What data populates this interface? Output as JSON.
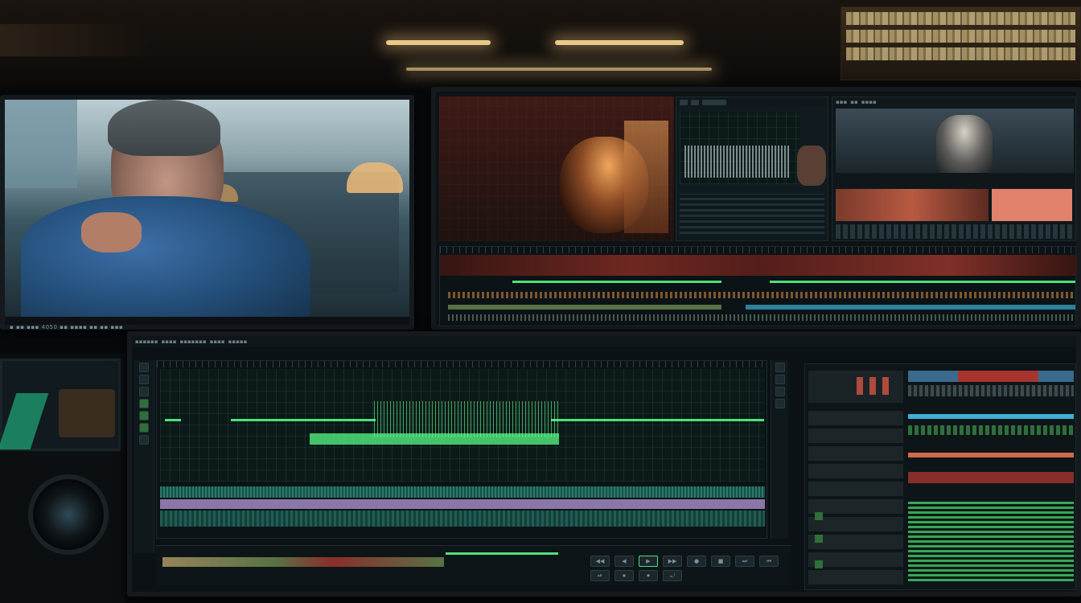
{
  "left_monitor": {
    "status_text": "▪ ▪▪ ▪▪▪ 4050 ▪▪ ▪▪▪▪ ▪▪ ▪▪ ▪▪▪"
  },
  "top_right_monitor": {
    "tabs": [
      "▪▪▪",
      "▪▪",
      "▪▪▪▪"
    ]
  },
  "main_editor": {
    "menu_items": [
      "▪▪▪▪▪▪",
      "▪▪▪▪",
      "▪▪▪▪▪▪▪",
      "▪▪▪▪",
      "▪▪▪▪▪"
    ],
    "transport": [
      "◀◀",
      "◀",
      "▶",
      "▶▶",
      "●",
      "■",
      "⏭",
      "⏮",
      "⏯",
      "⏹",
      "⏺",
      "⤾"
    ]
  },
  "icons": {
    "play": "play-icon",
    "stop": "stop-icon",
    "record": "record-icon"
  },
  "colors": {
    "waveform_green": "#4fe07a",
    "track_purple": "#b59ad8",
    "track_teal": "#1f5e55",
    "clip_red": "#a8342f",
    "accent_cyan": "#3fb0d6"
  }
}
